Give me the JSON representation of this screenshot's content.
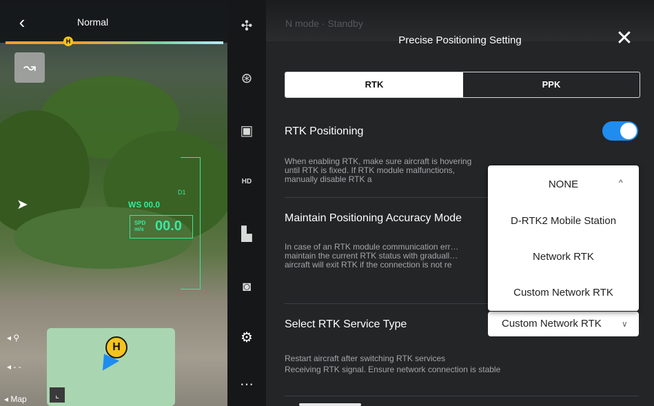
{
  "camera": {
    "mode_label": "Normal",
    "home_marker": "H",
    "ws_label": "WS 00.0",
    "spd_unit_top": "SPD",
    "spd_unit_bottom": "m/s",
    "spd_value": "00.0",
    "d1_label": "D1",
    "map_label": "Map",
    "map_home": "H",
    "icons": [
      "back-icon",
      "route-icon",
      "navigation-arrow-icon",
      "expand-icon"
    ]
  },
  "rail": {
    "icons": [
      "aircraft-icon",
      "compass-icon",
      "controller-icon",
      "hd-icon",
      "battery-icon",
      "camera-icon",
      "rtk-satellite-icon",
      "more-icon"
    ],
    "hd_label": "HD"
  },
  "panel": {
    "status_ghost": "N mode · Standby",
    "title": "Precise Positioning Setting",
    "close_symbol": "✕",
    "tabs": {
      "rtk": "RTK",
      "ppk": "PPK",
      "selected": "RTK"
    },
    "rtk_positioning": {
      "title": "RTK Positioning",
      "desc": "When enabling RTK, make sure aircraft is hovering until RTK is fixed. If RTK module malfunctions, manually disable RTK a",
      "enabled": true
    },
    "maintain": {
      "title": "Maintain Positioning Accuracy Mode",
      "desc": "In case of an RTK module communication err… maintain the current RTK status with graduall… aircraft will exit RTK if the connection is not re"
    },
    "service": {
      "title": "Select RTK Service Type",
      "selected": "Custom Network RTK",
      "note1": "Restart aircraft after switching RTK services",
      "note2": "Receiving RTK signal. Ensure network connection is stable"
    },
    "dropdown": {
      "options": [
        "NONE",
        "D-RTK2 Mobile Station",
        "Network RTK",
        "Custom Network RTK"
      ],
      "chevron": "^"
    }
  },
  "colors": {
    "accent": "#1f8cf0",
    "hud_green": "#3de6a0",
    "home_yellow": "#f6c31a"
  }
}
